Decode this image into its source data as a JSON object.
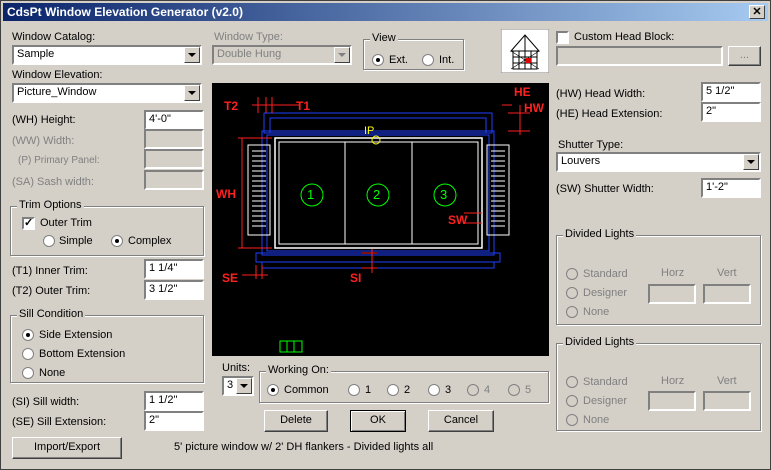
{
  "title": "CdsPt Window Elevation Generator (v2.0)",
  "close_glyph": "✕",
  "left": {
    "window_catalog_label": "Window Catalog:",
    "window_catalog_value": "Sample",
    "window_elevation_label": "Window Elevation:",
    "window_elevation_value": "Picture_Window",
    "height_label": "(WH) Height:",
    "height_value": "4'-0\"",
    "width_label": "(WW) Width:",
    "primary_panel_label": "(P) Primary Panel:",
    "sash_width_label": "(SA) Sash width:",
    "trim_options_title": "Trim Options",
    "outer_trim_label": "Outer Trim",
    "simple_label": "Simple",
    "complex_label": "Complex",
    "inner_trim_label": "(T1) Inner Trim:",
    "inner_trim_value": "1 1/4\"",
    "outer_trim_field_label": "(T2) Outer Trim:",
    "outer_trim_value": "3 1/2\"",
    "sill_condition_title": "Sill Condition",
    "side_extension_label": "Side Extension",
    "bottom_extension_label": "Bottom Extension",
    "none_label": "None",
    "sill_width_label": "(SI) Sill width:",
    "sill_width_value": "1 1/2\"",
    "sill_extension_label": "(SE) Sill Extension:",
    "sill_extension_value": "2\"",
    "import_export_label": "Import/Export"
  },
  "center": {
    "window_type_label": "Window Type:",
    "window_type_value": "Double Hung",
    "view_title": "View",
    "ext_label": "Ext.",
    "int_label": "Int.",
    "units_label": "Units:",
    "units_value": "3",
    "working_on_title": "Working On:",
    "working_options": [
      "Common",
      "1",
      "2",
      "3",
      "4",
      "5"
    ],
    "delete_label": "Delete",
    "ok_label": "OK",
    "cancel_label": "Cancel",
    "status_text": "5' picture window w/ 2' DH flankers - Divided lights all"
  },
  "drawing": {
    "labels": {
      "t2": "T2",
      "t1": "T1",
      "he": "HE",
      "hw": "HW",
      "ip": "IP",
      "wh": "WH",
      "sw": "SW",
      "se": "SE",
      "si": "SI"
    },
    "panels": [
      "1",
      "2",
      "3"
    ],
    "colors": {
      "dimension": "#ff2020",
      "frame": "#ffffff",
      "trim": "#2040ff",
      "panel_number": "#00ff00",
      "ip": "#ffff00"
    }
  },
  "right": {
    "custom_head_label": "Custom Head Block:",
    "browse_label": "...",
    "head_width_label": "(HW) Head Width:",
    "head_width_value": "5 1/2\"",
    "head_extension_label": "(HE) Head Extension:",
    "head_extension_value": "2\"",
    "shutter_type_label": "Shutter Type:",
    "shutter_type_value": "Louvers",
    "shutter_width_label": "(SW) Shutter Width:",
    "shutter_width_value": "1'-2\"",
    "divided_lights_1": {
      "title": "Divided Lights",
      "standard": "Standard",
      "designer": "Designer",
      "none": "None",
      "horz": "Horz",
      "vert": "Vert"
    },
    "divided_lights_2": {
      "title": "Divided Lights",
      "standard": "Standard",
      "designer": "Designer",
      "none": "None",
      "horz": "Horz",
      "vert": "Vert"
    }
  }
}
